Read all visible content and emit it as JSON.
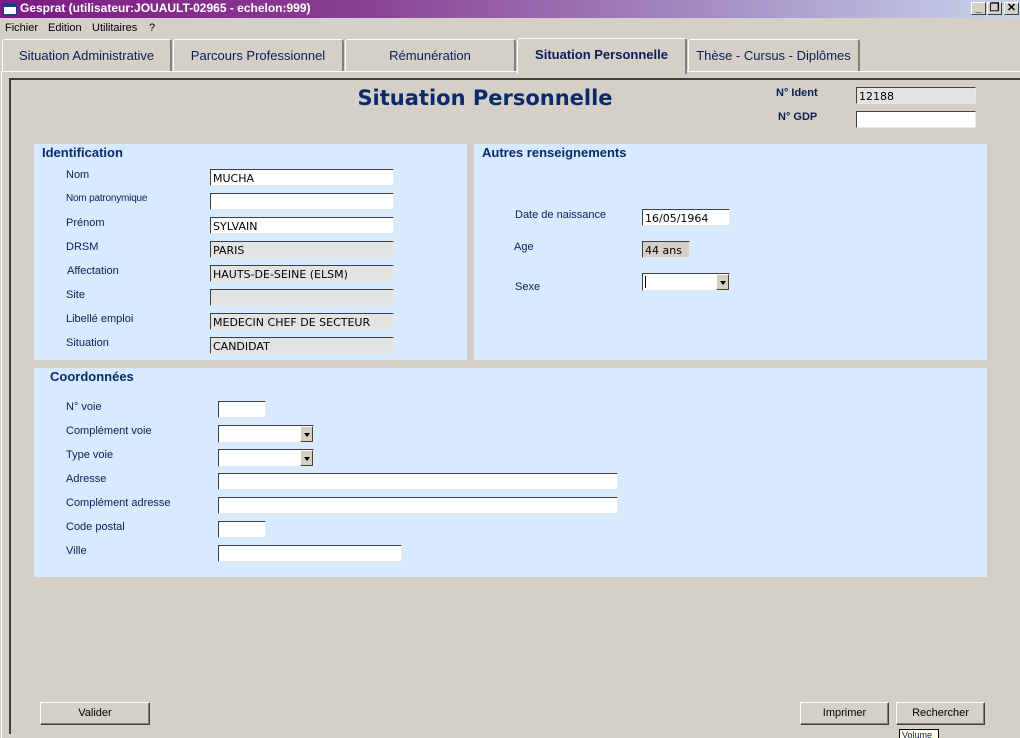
{
  "window": {
    "title": "Gesprat (utilisateur:JOUAULT-02965 - echelon:999)",
    "min_symbol": "_",
    "max_symbol": "❐",
    "close_symbol": "✕"
  },
  "menu": [
    "Fichier",
    "Edition",
    "Utilitaires",
    "?"
  ],
  "tabs": [
    {
      "label": "Situation Administrative"
    },
    {
      "label": "Parcours Professionnel"
    },
    {
      "label": "Rémunération"
    },
    {
      "label": "Situation Personnelle"
    },
    {
      "label": "Thèse - Cursus - Diplômes"
    }
  ],
  "active_tab": "Situation Personnelle",
  "page": {
    "title": "Situation Personnelle",
    "ident_label": "N° Ident",
    "ident_value": "12188",
    "gdp_label": "N° GDP",
    "gdp_value": ""
  },
  "identification": {
    "title": "Identification",
    "fields": [
      {
        "label": "Nom",
        "value": "MUCHA"
      },
      {
        "label": "Nom patronymique",
        "value": ""
      },
      {
        "label": "Prénom",
        "value": "SYLVAIN"
      },
      {
        "label": "DRSM",
        "value": "PARIS"
      },
      {
        "label": "Affectation",
        "value": "HAUTS-DE-SEINE (ELSM)"
      },
      {
        "label": "Site",
        "value": ""
      },
      {
        "label": "Libellé emploi",
        "value": "MEDECIN CHEF DE SECTEUR"
      },
      {
        "label": "Situation",
        "value": "CANDIDAT"
      }
    ]
  },
  "autres": {
    "title": "Autres renseignements",
    "birth_label": "Date de naissance",
    "birth_value": "16/05/1964",
    "age_label": "Age",
    "age_value": "44 ans",
    "sexe_label": "Sexe",
    "sexe_value": ""
  },
  "coordonnees": {
    "title": "Coordonnées",
    "fields": [
      {
        "label": "N° voie",
        "value": ""
      },
      {
        "label": "Complément voie",
        "value": ""
      },
      {
        "label": "Type voie",
        "value": ""
      },
      {
        "label": "Adresse",
        "value": ""
      },
      {
        "label": "Complément adresse",
        "value": ""
      },
      {
        "label": "Code postal",
        "value": ""
      },
      {
        "label": "Ville",
        "value": ""
      }
    ]
  },
  "buttons": {
    "valider": "Valider",
    "imprimer": "Imprimer",
    "rechercher": "Rechercher"
  },
  "tooltip": "Volume"
}
